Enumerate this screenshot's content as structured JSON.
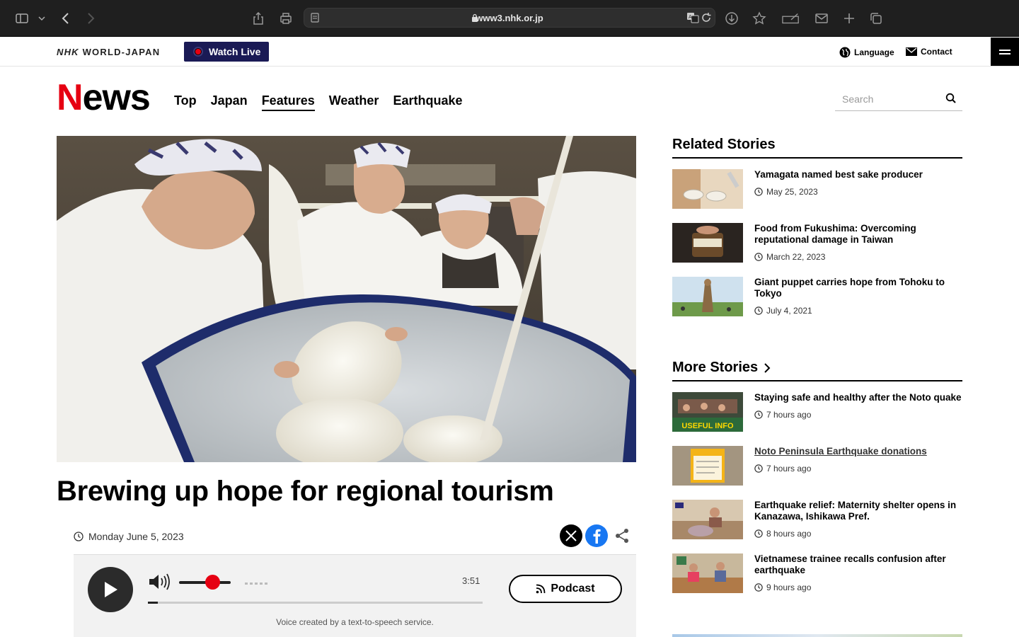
{
  "browser": {
    "url": "www3.nhk.or.jp"
  },
  "site": {
    "logo_prefix": "NHK",
    "logo_suffix": "WORLD-JAPAN",
    "watch_live": "Watch Live",
    "language": "Language",
    "contact": "Contact"
  },
  "header": {
    "news_n": "N",
    "news_rest": "ews",
    "nav": [
      "Top",
      "Japan",
      "Features",
      "Weather",
      "Earthquake"
    ],
    "active_nav": "Features",
    "search_placeholder": "Search"
  },
  "article": {
    "headline": "Brewing up hope for regional tourism",
    "date": "Monday June 5, 2023",
    "player": {
      "duration": "3:51",
      "podcast_label": "Podcast",
      "tts_note": "Voice created by a text-to-speech service.",
      "progress": 0.03
    }
  },
  "related": {
    "title": "Related Stories",
    "items": [
      {
        "title": "Yamagata named best sake producer",
        "time": "May 25, 2023"
      },
      {
        "title": "Food from Fukushima: Overcoming reputational damage in Taiwan",
        "time": "March 22, 2023"
      },
      {
        "title": "Giant puppet carries hope from Tohoku to Tokyo",
        "time": "July 4, 2021"
      }
    ]
  },
  "more": {
    "title": "More Stories",
    "items": [
      {
        "title": "Staying safe and healthy after the Noto quake",
        "time": "7 hours ago",
        "thumb_text": "USEFUL INFO"
      },
      {
        "title": "Noto Peninsula Earthquake donations",
        "time": "7 hours ago"
      },
      {
        "title": "Earthquake relief: Maternity shelter opens in Kanazawa, Ishikawa Pref.",
        "time": "8 hours ago"
      },
      {
        "title": "Vietnamese trainee recalls confusion after earthquake",
        "time": "9 hours ago"
      }
    ]
  },
  "colors": {
    "brand_red": "#e60012",
    "watch_live_bg": "#1a1a55",
    "facebook_blue": "#1877f2"
  }
}
